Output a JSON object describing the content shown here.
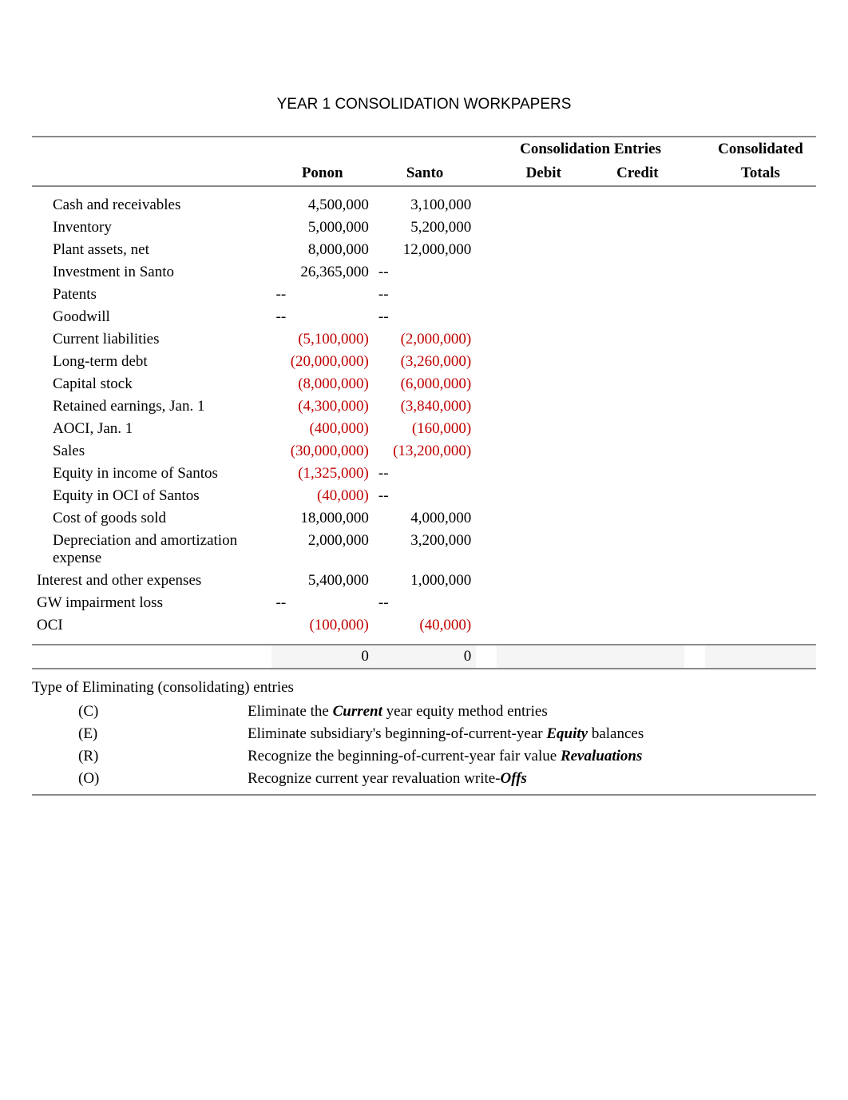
{
  "title": "YEAR 1 CONSOLIDATION WORKPAPERS",
  "headers": {
    "ponon": "Ponon",
    "santo": "Santo",
    "consolidation_entries": "Consolidation Entries",
    "debit": "Debit",
    "credit": "Credit",
    "consolidated_totals_1": "Consolidated",
    "consolidated_totals_2": "Totals"
  },
  "rows": [
    {
      "label": "Cash and receivables",
      "ponon": "4,500,000",
      "santo": "3,100,000",
      "indent": true
    },
    {
      "label": "Inventory",
      "ponon": "5,000,000",
      "santo": "5,200,000",
      "indent": true
    },
    {
      "label": "Plant assets, net",
      "ponon": "8,000,000",
      "santo": "12,000,000",
      "indent": true
    },
    {
      "label": "Investment in Santo",
      "ponon": "26,365,000",
      "santo": "--",
      "indent": true,
      "santo_dash": true
    },
    {
      "label": "Patents",
      "ponon": "--",
      "santo": "--",
      "indent": true,
      "both_dash": true
    },
    {
      "label": "Goodwill",
      "ponon": "--",
      "santo": "--",
      "indent": true,
      "both_dash": true
    },
    {
      "label": "Current liabilities",
      "ponon": "(5,100,000)",
      "santo": "(2,000,000)",
      "indent": true,
      "neg": true
    },
    {
      "label": "Long-term debt",
      "ponon": "(20,000,000)",
      "santo": "(3,260,000)",
      "indent": true,
      "neg": true
    },
    {
      "label": "Capital stock",
      "ponon": "(8,000,000)",
      "santo": "(6,000,000)",
      "indent": true,
      "neg": true
    },
    {
      "label": "Retained earnings, Jan. 1",
      "ponon": "(4,300,000)",
      "santo": "(3,840,000)",
      "indent": true,
      "neg": true
    },
    {
      "label": "AOCI, Jan. 1",
      "ponon": "(400,000)",
      "santo": "(160,000)",
      "indent": true,
      "neg": true
    },
    {
      "label": "Sales",
      "ponon": "(30,000,000)",
      "santo": "(13,200,000)",
      "indent": true,
      "neg": true
    },
    {
      "label": "Equity in income of Santos",
      "ponon": "(1,325,000)",
      "santo": "--",
      "indent": true,
      "neg_ponon": true,
      "santo_dash": true
    },
    {
      "label": "Equity in OCI of Santos",
      "ponon": "(40,000)",
      "santo": "--",
      "indent": true,
      "neg_ponon": true,
      "santo_dash": true
    },
    {
      "label": "Cost of goods sold",
      "ponon": "18,000,000",
      "santo": "4,000,000",
      "indent": true
    },
    {
      "label": "Depreciation and amortization expense",
      "ponon": "2,000,000",
      "santo": "3,200,000",
      "indent": true
    },
    {
      "label": "Interest and other expenses",
      "ponon": "5,400,000",
      "santo": "1,000,000"
    },
    {
      "label": "GW impairment loss",
      "ponon": "--",
      "santo": "--",
      "both_dash": true
    },
    {
      "label": "OCI",
      "ponon": "(100,000)",
      "santo": "(40,000)",
      "neg": true
    }
  ],
  "totals": {
    "ponon": "0",
    "santo": "0"
  },
  "notes": {
    "title": "Type of Eliminating (consolidating) entries",
    "items": [
      {
        "code": "(C)",
        "pre": "Eliminate the ",
        "em": "Current",
        "post": " year equity method entries"
      },
      {
        "code": "(E)",
        "pre": "Eliminate subsidiary's beginning-of-current-year ",
        "em": "Equity",
        "post": " balances"
      },
      {
        "code": "(R)",
        "pre": "Recognize the beginning-of-current-year fair value ",
        "em": "Revaluations",
        "post": ""
      },
      {
        "code": "(O)",
        "pre": "Recognize current year revaluation write-",
        "em": "Offs",
        "post": ""
      }
    ]
  }
}
